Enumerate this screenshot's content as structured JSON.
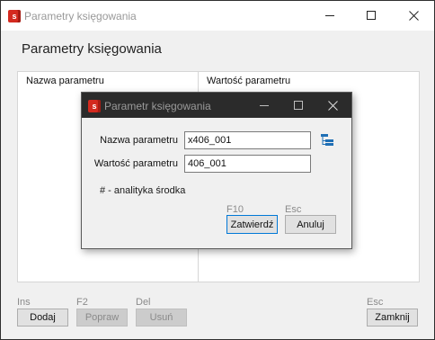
{
  "main_window": {
    "title": "Parametry księgowania",
    "dialog_title": "Parametry księgowania",
    "columns": [
      "Nazwa parametru",
      "Wartość parametru"
    ],
    "buttons": [
      {
        "key": "Ins",
        "label": "Dodaj",
        "enabled": true
      },
      {
        "key": "F2",
        "label": "Popraw",
        "enabled": false
      },
      {
        "key": "Del",
        "label": "Usuń",
        "enabled": false
      }
    ],
    "close_button": {
      "key": "Esc",
      "label": "Zamknij"
    }
  },
  "modal": {
    "title": "Parametr księgowania",
    "name_label": "Nazwa parametru",
    "name_value": "x406_001",
    "value_label": "Wartość parametru",
    "value_value": "406_001",
    "hint": "# - analityka środka",
    "confirm": {
      "key": "F10",
      "label": "Zatwierdź"
    },
    "cancel": {
      "key": "Esc",
      "label": "Anuluj"
    }
  },
  "logo_letter": "s",
  "icons": {
    "app": "app-logo-icon",
    "minimize": "minimize-icon",
    "maximize": "maximize-icon",
    "close": "close-icon",
    "picker": "tree-picker-icon"
  },
  "colors": {
    "logo_red": "#d42a1f",
    "modal_titlebar": "#2b2b2b",
    "picker_blue": "#1f6fb5",
    "default_button_border": "#0078d7"
  }
}
